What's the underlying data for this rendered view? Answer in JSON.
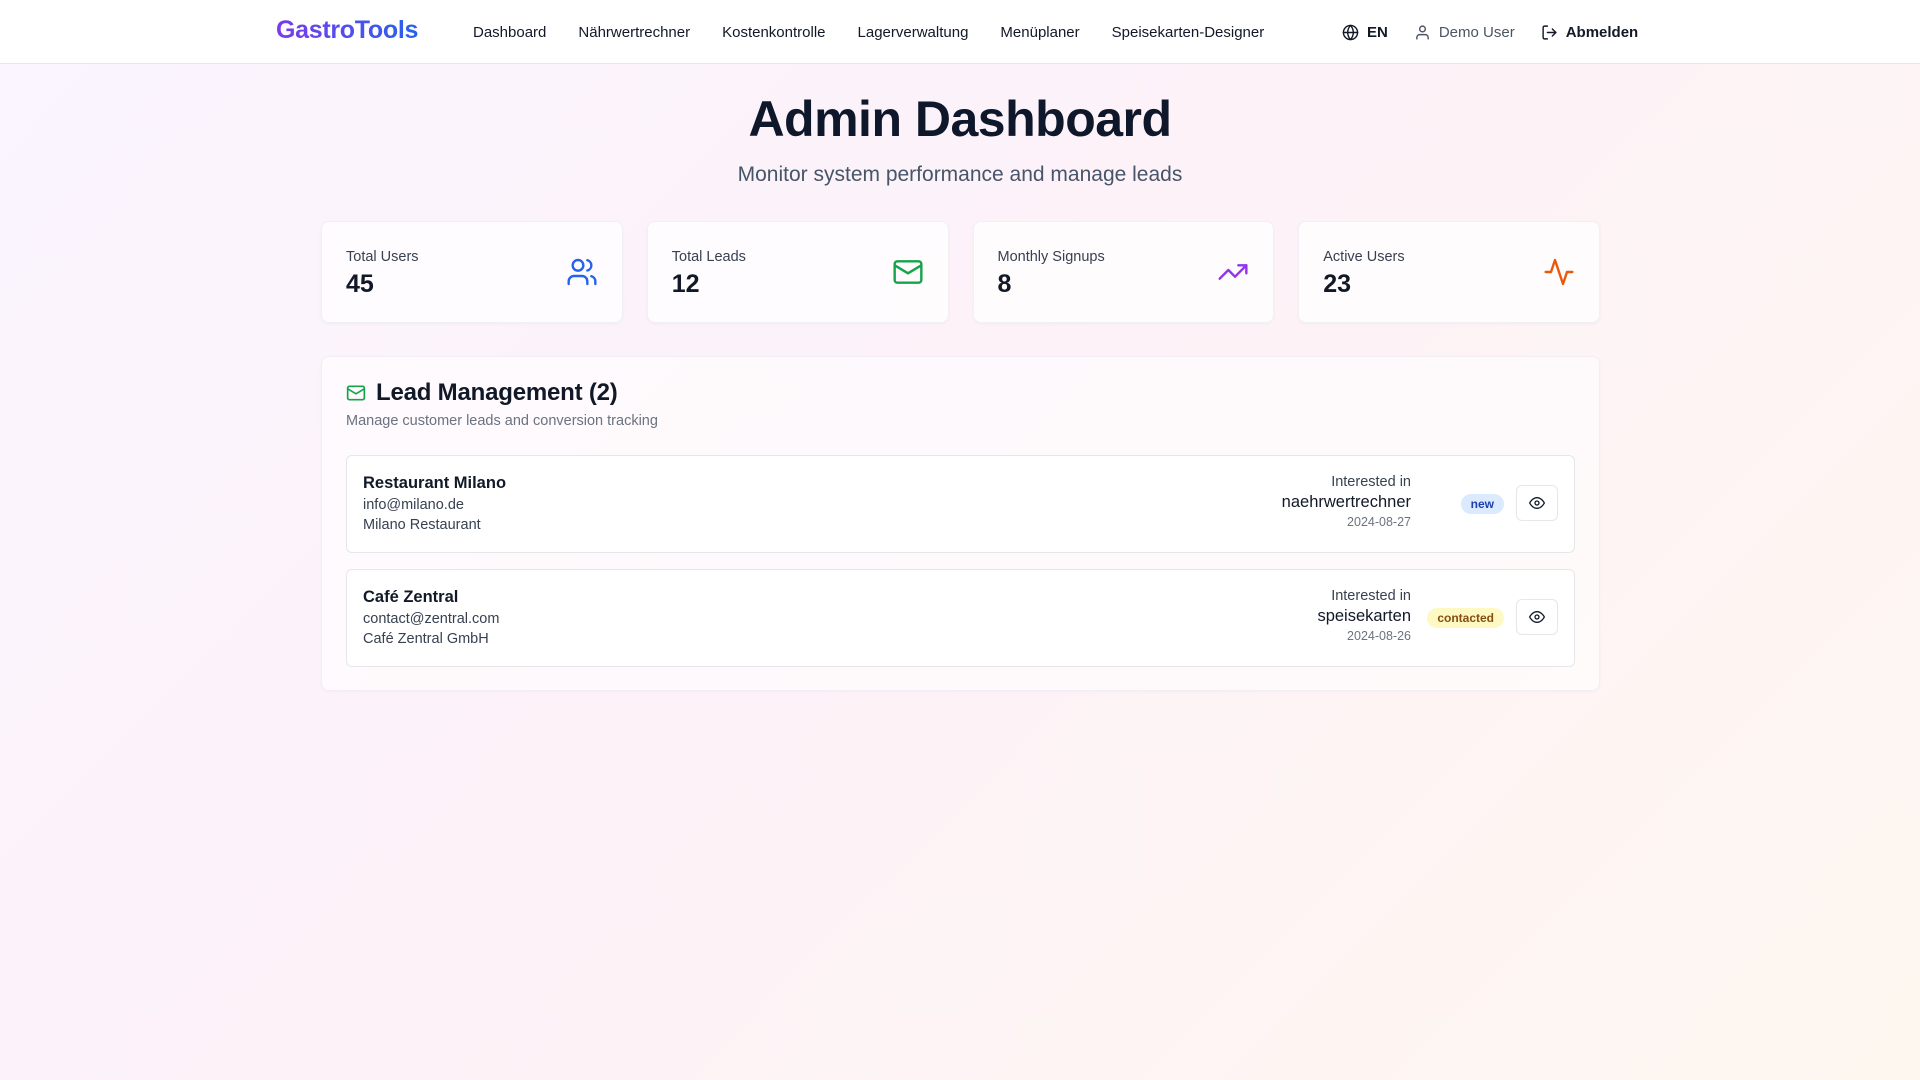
{
  "header": {
    "logo": "GastroTools",
    "nav": [
      "Dashboard",
      "Nährwertrechner",
      "Kostenkontrolle",
      "Lagerverwaltung",
      "Menüplaner",
      "Speisekarten-Designer"
    ],
    "language": "EN",
    "user": "Demo User",
    "logout": "Abmelden"
  },
  "page": {
    "title": "Admin Dashboard",
    "subtitle": "Monitor system performance and manage leads"
  },
  "stats": [
    {
      "label": "Total Users",
      "value": "45",
      "icon": "users-icon",
      "color": "#2563eb"
    },
    {
      "label": "Total Leads",
      "value": "12",
      "icon": "mail-icon",
      "color": "#16a34a"
    },
    {
      "label": "Monthly Signups",
      "value": "8",
      "icon": "trending-up-icon",
      "color": "#9333ea"
    },
    {
      "label": "Active Users",
      "value": "23",
      "icon": "activity-icon",
      "color": "#ea580c"
    }
  ],
  "leads": {
    "title": "Lead Management (2)",
    "description": "Manage customer leads and conversion tracking",
    "items": [
      {
        "name": "Restaurant Milano",
        "email": "info@milano.de",
        "company": "Milano Restaurant",
        "interest_label": "Interested in",
        "interest": "naehrwertrechner",
        "date": "2024-08-27",
        "status": "new"
      },
      {
        "name": "Café Zentral",
        "email": "contact@zentral.com",
        "company": "Café Zentral GmbH",
        "interest_label": "Interested in",
        "interest": "speisekarten",
        "date": "2024-08-26",
        "status": "contacted"
      }
    ]
  }
}
